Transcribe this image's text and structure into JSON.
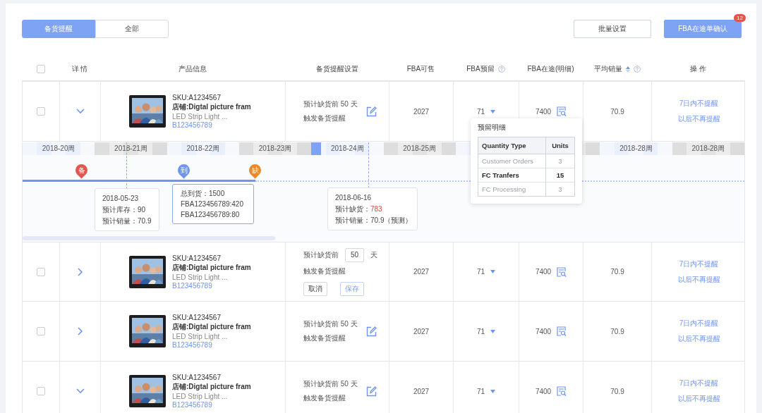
{
  "tabs": [
    {
      "label": "备货提醒",
      "selected": true
    },
    {
      "label": "全部",
      "selected": false
    }
  ],
  "toolbar_buttons": [
    {
      "label": "批量设置",
      "kind": "outline"
    },
    {
      "label": "FBA在途单确认",
      "kind": "primary",
      "badge": "12"
    }
  ],
  "table": {
    "columns": [
      {
        "kind": "checkbox",
        "checked": false
      },
      {
        "kind": "text",
        "label": "详 情"
      },
      {
        "kind": "text",
        "label": "产品信息"
      },
      {
        "kind": "text",
        "label": "备货提醒设置"
      },
      {
        "kind": "text",
        "label": "FBA可售"
      },
      {
        "kind": "text",
        "label": "FBA预留",
        "help": true
      },
      {
        "kind": "text",
        "label": "FBA在途(明细)"
      },
      {
        "kind": "text",
        "label": "平均销量",
        "sortable": true,
        "help": true
      },
      {
        "kind": "text",
        "label": "操 作"
      }
    ],
    "rows": [
      {
        "checked": false,
        "expanded": true,
        "sku": "SKU:A1234567",
        "store": "店铺:Digtal picture fram",
        "title": "LED Strip Light ...",
        "asin": "B123456789",
        "reminder": {
          "kind": "view",
          "text": "预计缺货前 50 天",
          "text2": "触发备货提醒"
        },
        "fba_available": "2027",
        "fba_reserved": "71",
        "fba_inbound": "7400",
        "avg_sales": "70.9",
        "actions": [
          "7日内不提醒",
          "以后不再提醒"
        ],
        "reserved_detail": {
          "title": "预留明细",
          "columns": [
            "Quantity Type",
            "Units"
          ],
          "rows": [
            {
              "type": "Customer Orders",
              "units": "3",
              "disabled": true
            },
            {
              "type": "FC Tranfers",
              "units": "15",
              "disabled": false
            },
            {
              "type": "FC Processing",
              "units": "3",
              "disabled": true
            }
          ]
        },
        "detail": {
          "weeks": [
            {
              "label": "2018-20周",
              "current": false
            },
            {
              "label": "2018-21周",
              "current": false
            },
            {
              "label": "2018-22周",
              "current": false
            },
            {
              "label": "2018-23周",
              "current": false
            },
            {
              "label": "2018-24周",
              "current": true
            },
            {
              "label": "2018-25周",
              "current": false
            },
            {
              "current": false
            },
            {
              "current": false
            },
            {
              "label": "2018-28周",
              "current": false
            },
            {
              "label": "2018-28周",
              "current": false
            }
          ],
          "pins": [
            {
              "label": "备",
              "color": "#e0584c"
            },
            {
              "label": "到",
              "color": "#6f95ec"
            },
            {
              "label": "缺",
              "color": "#e8892b"
            }
          ],
          "callouts": [
            {
              "kind": "plain",
              "lines": [
                {
                  "text": "2018-05-23"
                },
                {
                  "text": "预计库存：90"
                },
                {
                  "text": "预计销量：70.9"
                }
              ]
            },
            {
              "kind": "highlight",
              "lines": [
                {
                  "text": "总到货：1500"
                },
                {
                  "text": "FBA123456789:420"
                },
                {
                  "text": "FBA123456789:80"
                }
              ]
            },
            {
              "kind": "plain",
              "lines": [
                {
                  "text": "2018-06-16"
                },
                {
                  "text": "预计缺货：",
                  "value": "783",
                  "alert": true
                },
                {
                  "text": "预计销量：70.9（预测）"
                }
              ]
            }
          ]
        }
      },
      {
        "checked": false,
        "expanded": false,
        "sku": "SKU:A1234567",
        "store": "店铺:Digtal picture fram",
        "title": "LED Strip Light ...",
        "asin": "B123456789",
        "reminder": {
          "kind": "edit",
          "before": "预计缺货前",
          "days": "50",
          "unit": "天",
          "text2": "触发备货提醒",
          "buttons": [
            {
              "label": "取消",
              "kind": "cancel"
            },
            {
              "label": "保存",
              "kind": "save"
            }
          ]
        },
        "fba_available": "2027",
        "fba_reserved": "71",
        "fba_inbound": "7400",
        "avg_sales": "70.9",
        "actions": [
          "7日内不提醒",
          "以后不再提醒"
        ]
      },
      {
        "checked": false,
        "expanded": false,
        "sku": "SKU:A1234567",
        "store": "店铺:Digtal picture fram",
        "title": "LED Strip Light ...",
        "asin": "B123456789",
        "reminder": {
          "kind": "view",
          "text": "预计缺货前 50 天",
          "text2": "触发备货提醒"
        },
        "fba_available": "2027",
        "fba_reserved": "71",
        "fba_inbound": "7400",
        "avg_sales": "70.9",
        "actions": [
          "7日内不提醒",
          "以后不再提醒"
        ]
      },
      {
        "checked": false,
        "expanded": true,
        "sku": "SKU:A1234567",
        "store": "店铺:Digtal picture fram",
        "title": "LED Strip Light ...",
        "asin": "B123456789",
        "reminder": {
          "kind": "view",
          "text": "预计缺货前 50 天",
          "text2": "触发备货提醒"
        },
        "fba_available": "2027",
        "fba_reserved": "71",
        "fba_inbound": "7400",
        "avg_sales": "70.9",
        "actions": [
          "7日内不提醒",
          "以后不再提醒"
        ]
      }
    ]
  }
}
